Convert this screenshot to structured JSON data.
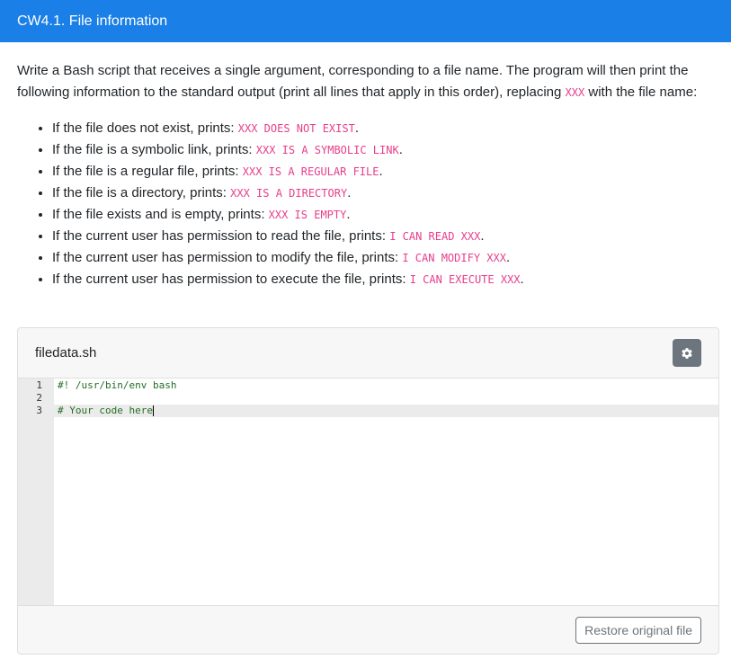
{
  "header": {
    "title": "CW4.1. File information"
  },
  "intro": {
    "part1": "Write a Bash script that receives a single argument, corresponding to a file name. The program will then print the following information to the standard output (print all lines that apply in this order), replacing ",
    "code": "XXX",
    "part2": " with the file name:"
  },
  "rules": [
    {
      "text": "If the file does not exist, prints: ",
      "code": "XXX DOES NOT EXIST",
      "end": "."
    },
    {
      "text": "If the file is a symbolic link, prints: ",
      "code": "XXX IS A SYMBOLIC LINK",
      "end": "."
    },
    {
      "text": "If the file is a regular file, prints: ",
      "code": "XXX IS A REGULAR FILE",
      "end": "."
    },
    {
      "text": "If the file is a directory, prints: ",
      "code": "XXX IS A DIRECTORY",
      "end": "."
    },
    {
      "text": "If the file exists and is empty, prints: ",
      "code": "XXX IS EMPTY",
      "end": "."
    },
    {
      "text": "If the current user has permission to read the file, prints: ",
      "code": "I CAN READ XXX",
      "end": "."
    },
    {
      "text": "If the current user has permission to modify the file, prints: ",
      "code": "I CAN MODIFY XXX",
      "end": "."
    },
    {
      "text": "If the current user has permission to execute the file, prints: ",
      "code": "I CAN EXECUTE XXX",
      "end": "."
    }
  ],
  "editor": {
    "filename": "filedata.sh",
    "settings_icon": "gear-icon",
    "lines": [
      {
        "number": "1",
        "text": "#! /usr/bin/env bash"
      },
      {
        "number": "2",
        "text": ""
      },
      {
        "number": "3",
        "text": "# Your code here"
      }
    ],
    "restore_label": "Restore original file"
  },
  "colors": {
    "header_bg": "#1a7fe6",
    "code_pink": "#e83e8c",
    "comment_green": "#236e25",
    "secondary": "#6c757d"
  }
}
